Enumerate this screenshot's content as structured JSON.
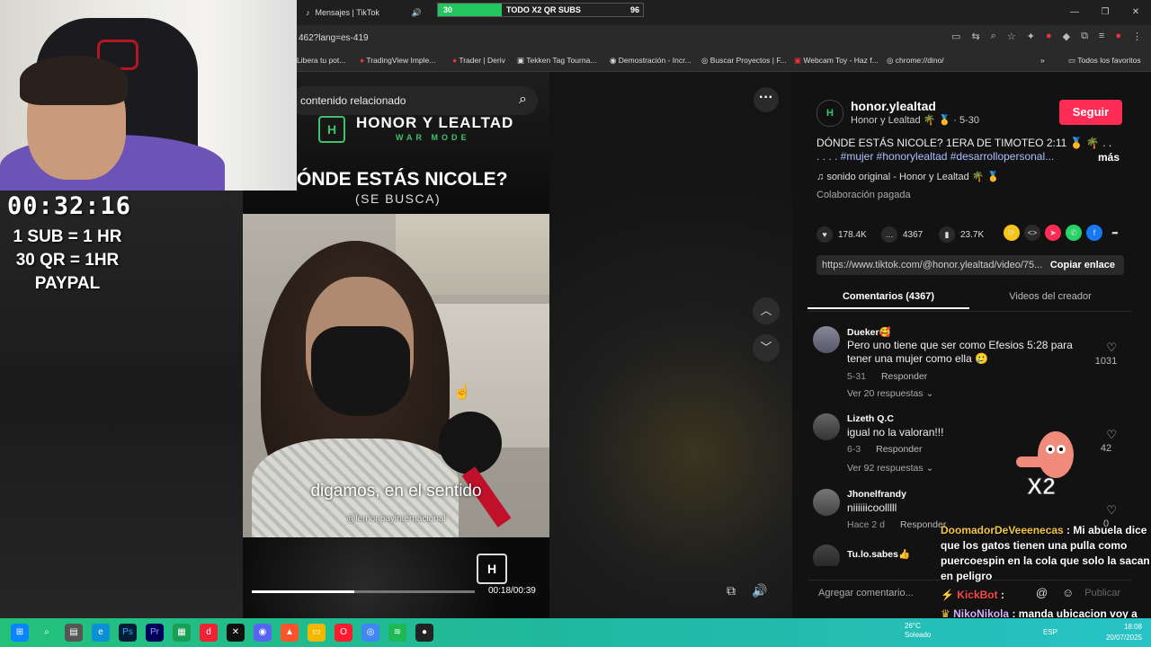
{
  "browser": {
    "tab_title": "Mensajes | TikTok",
    "url": "462?lang=es-419",
    "progress": {
      "current": "30",
      "label": "TODO X2 QR SUBS",
      "goal": "96",
      "fraction": 0.31
    },
    "bookmarks": [
      "Libera tu pot...",
      "TradingView Imple...",
      "Trader | Deriv",
      "Tekken Tag Tourna...",
      "Demostración - Incr...",
      "Buscar Proyectos | F...",
      "Webcam Toy - Haz f...",
      "chrome://dino/",
      "Todos los favoritos"
    ]
  },
  "video": {
    "search_placeholder": "contenido relacionado",
    "brand_name": "HONOR Y LEALTAD",
    "brand_mode": "WAR MODE",
    "brand_logo": "H",
    "headline": "ÓNDE ESTÁS NICOLE?",
    "subhead": "(SE BUSCA)",
    "subtitle": "digamos, en el sentido",
    "watermark": "@lemonpayinternacional",
    "time": "00:18/00:39",
    "progress_fraction": 0.46
  },
  "panel": {
    "creator": "honor.ylealtad",
    "creator_sub": "Honor y Lealtad 🌴 🥇 · 5-30",
    "follow_label": "Seguir",
    "description": "DÓNDE ESTÁS NICOLE? 1ERA DE TIMOTEO 2:11 🥇 🌴 . .",
    "description_tags": ". . . . #mujer #honorylealtad #desarrollopersonal...",
    "more_label": "más",
    "sound": "sonido original - Honor y Lealtad 🌴 🥇",
    "paid": "Colaboración pagada",
    "likes": "178.4K",
    "comments_count": "4367",
    "saves": "23.7K",
    "link": "https://www.tiktok.com/@honor.ylealtad/video/75...",
    "copy_label": "Copiar enlace",
    "tab_comments": "Comentarios (4367)",
    "tab_videos": "Videos del creador",
    "add_comment_placeholder": "Agregar comentario...",
    "publish_label": "Publicar"
  },
  "comments": [
    {
      "user": "Dueker🥰",
      "text": "Pero uno tiene que ser como Efesios 5:28 para tener una mujer como ella 🥲",
      "date": "5-31",
      "reply": "Responder",
      "replies": "Ver 20 respuestas",
      "likes": "1031"
    },
    {
      "user": "Lizeth Q.C",
      "text": "igual no la valoran!!!",
      "date": "6-3",
      "reply": "Responder",
      "replies": "Ver 92 respuestas",
      "likes": "42"
    },
    {
      "user": "Jhonelfrandy",
      "text": "niiiiiicoolllll",
      "date": "Hace 2 d",
      "reply": "Responder",
      "likes": "0"
    },
    {
      "user": "Tu.lo.sabes👍"
    }
  ],
  "overlay": {
    "timer": "00:32:16",
    "rule1": "1 SUB = 1 HR",
    "rule2": "30 QR = 1HR",
    "rule3": "PAYPAL",
    "x2_label": "X2"
  },
  "chat": [
    {
      "user": "DoomadorDeVeeenecas",
      "message": ": Mi abuela dice que los gatos tienen una pulla como puercoespin en la cola que solo la sacan en peligro"
    },
    {
      "user": "KickBot",
      "message": ":"
    },
    {
      "user": "NikoNikola",
      "message": ": manda ubicacion voy a envenenar al dueño"
    }
  ],
  "taskbar": {
    "weather_temp": "26°C",
    "weather_desc": "Soleado",
    "lang": "ESP",
    "time": "18:08",
    "date": "20/07/2025"
  },
  "colors": {
    "accent": "#fe2c55",
    "taskbar": "#23c07a",
    "brand_green": "#3ec26a"
  }
}
